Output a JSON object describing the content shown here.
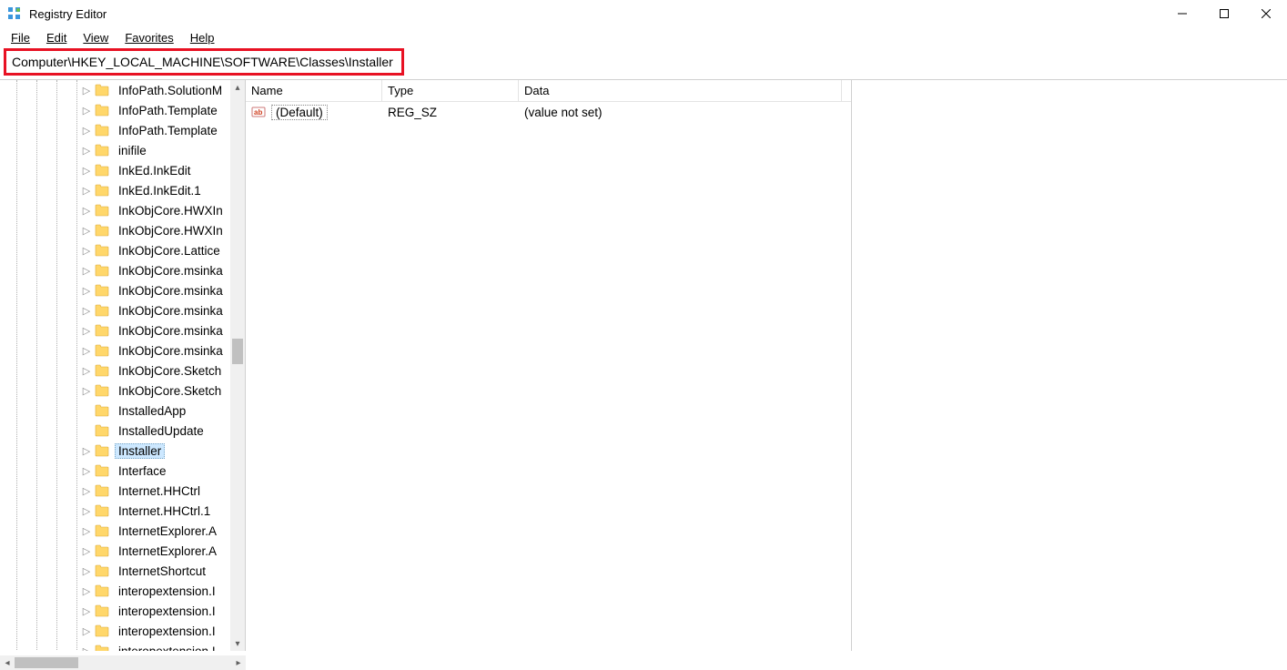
{
  "title": "Registry Editor",
  "menu": {
    "file": "File",
    "edit": "Edit",
    "view": "View",
    "favorites": "Favorites",
    "help": "Help"
  },
  "address": "Computer\\HKEY_LOCAL_MACHINE\\SOFTWARE\\Classes\\Installer",
  "tree": [
    {
      "label": "InfoPath.SolutionM",
      "expandable": true
    },
    {
      "label": "InfoPath.Template",
      "expandable": true
    },
    {
      "label": "InfoPath.Template",
      "expandable": true
    },
    {
      "label": "inifile",
      "expandable": true
    },
    {
      "label": "InkEd.InkEdit",
      "expandable": true
    },
    {
      "label": "InkEd.InkEdit.1",
      "expandable": true
    },
    {
      "label": "InkObjCore.HWXIn",
      "expandable": true
    },
    {
      "label": "InkObjCore.HWXIn",
      "expandable": true
    },
    {
      "label": "InkObjCore.Lattice",
      "expandable": true
    },
    {
      "label": "InkObjCore.msinka",
      "expandable": true
    },
    {
      "label": "InkObjCore.msinka",
      "expandable": true
    },
    {
      "label": "InkObjCore.msinka",
      "expandable": true
    },
    {
      "label": "InkObjCore.msinka",
      "expandable": true
    },
    {
      "label": "InkObjCore.msinka",
      "expandable": true
    },
    {
      "label": "InkObjCore.Sketch",
      "expandable": true
    },
    {
      "label": "InkObjCore.Sketch",
      "expandable": true
    },
    {
      "label": "InstalledApp",
      "expandable": false
    },
    {
      "label": "InstalledUpdate",
      "expandable": false
    },
    {
      "label": "Installer",
      "expandable": true,
      "selected": true
    },
    {
      "label": "Interface",
      "expandable": true
    },
    {
      "label": "Internet.HHCtrl",
      "expandable": true
    },
    {
      "label": "Internet.HHCtrl.1",
      "expandable": true
    },
    {
      "label": "InternetExplorer.A",
      "expandable": true
    },
    {
      "label": "InternetExplorer.A",
      "expandable": true
    },
    {
      "label": "InternetShortcut",
      "expandable": true
    },
    {
      "label": "interopextension.I",
      "expandable": true
    },
    {
      "label": "interopextension.I",
      "expandable": true
    },
    {
      "label": "interopextension.I",
      "expandable": true
    },
    {
      "label": "interopextension.I",
      "expandable": true
    }
  ],
  "list": {
    "columns": {
      "name": "Name",
      "type": "Type",
      "data": "Data"
    },
    "rows": [
      {
        "name": "(Default)",
        "type": "REG_SZ",
        "data": "(value not set)"
      }
    ]
  }
}
